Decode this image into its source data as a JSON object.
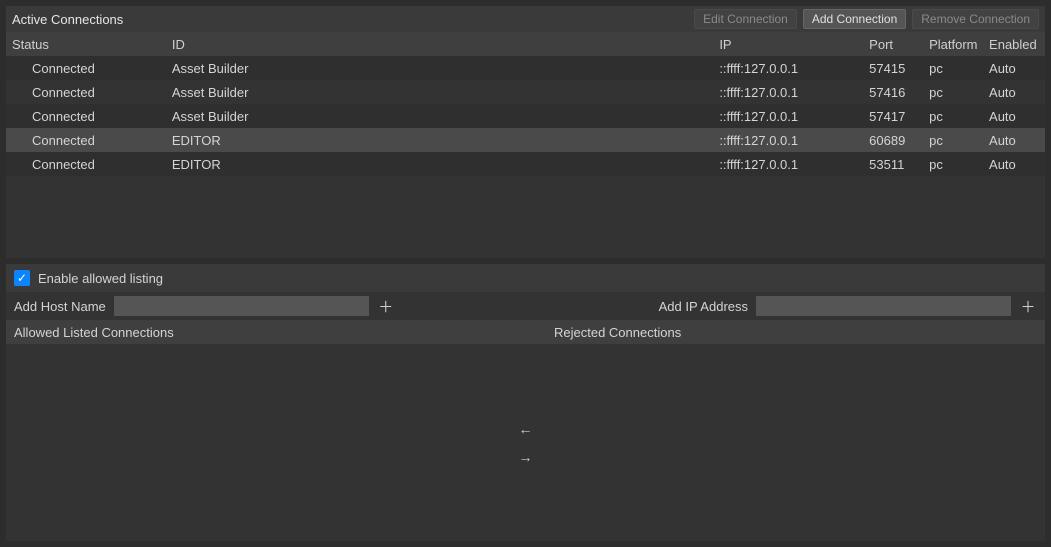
{
  "header": {
    "title": "Active Connections",
    "edit_btn": "Edit Connection",
    "add_btn": "Add Connection",
    "remove_btn": "Remove Connection"
  },
  "columns": {
    "status": "Status",
    "id": "ID",
    "ip": "IP",
    "port": "Port",
    "platform": "Platform",
    "enabled": "Enabled"
  },
  "rows": [
    {
      "status": "Connected",
      "id": "Asset Builder",
      "ip": "::ffff:127.0.0.1",
      "port": "57415",
      "platform": "pc",
      "enabled": "Auto",
      "selected": false
    },
    {
      "status": "Connected",
      "id": "Asset Builder",
      "ip": "::ffff:127.0.0.1",
      "port": "57416",
      "platform": "pc",
      "enabled": "Auto",
      "selected": false
    },
    {
      "status": "Connected",
      "id": "Asset Builder",
      "ip": "::ffff:127.0.0.1",
      "port": "57417",
      "platform": "pc",
      "enabled": "Auto",
      "selected": false
    },
    {
      "status": "Connected",
      "id": "EDITOR",
      "ip": "::ffff:127.0.0.1",
      "port": "60689",
      "platform": "pc",
      "enabled": "Auto",
      "selected": true
    },
    {
      "status": "Connected",
      "id": "EDITOR",
      "ip": "::ffff:127.0.0.1",
      "port": "53511",
      "platform": "pc",
      "enabled": "Auto",
      "selected": false
    }
  ],
  "filter": {
    "enable_label": "Enable allowed listing",
    "enable_checked": true,
    "add_host_label": "Add Host Name",
    "add_host_value": "",
    "add_ip_label": "Add IP Address",
    "add_ip_value": ""
  },
  "lists": {
    "allowed_header": "Allowed Listed Connections",
    "rejected_header": "Rejected Connections"
  }
}
